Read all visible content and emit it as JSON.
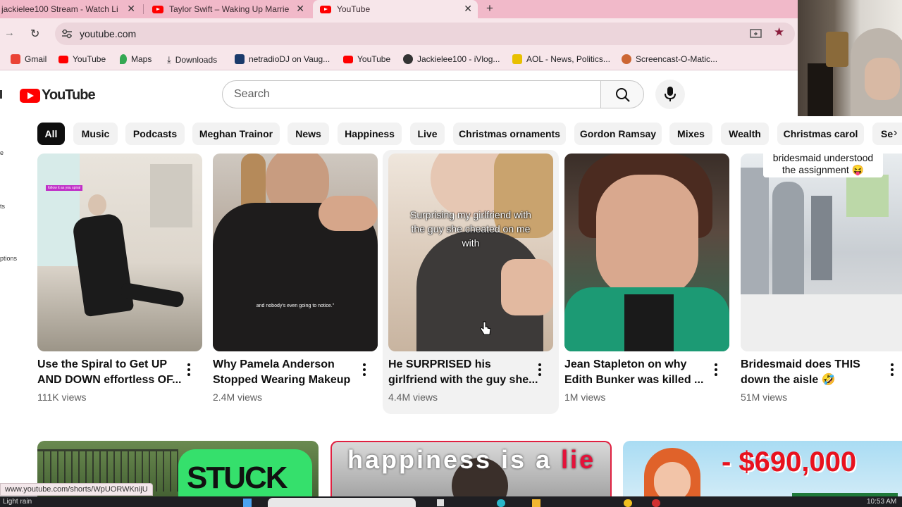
{
  "browser": {
    "tabs": [
      {
        "title": "jackielee100 Stream - Watch Li"
      },
      {
        "title": "Taylor Swift – Waking Up Marrie"
      },
      {
        "title": "YouTube"
      }
    ],
    "new_tab_label": "+",
    "url": "youtube.com",
    "bookmarks": [
      {
        "label": "Gmail",
        "icon": "gmail-icon",
        "color": "#ea4335"
      },
      {
        "label": "YouTube",
        "icon": "youtube-icon",
        "color": "#ff0000"
      },
      {
        "label": "Maps",
        "icon": "maps-pin-icon",
        "color": "#34a853"
      },
      {
        "label": "Downloads",
        "icon": "download-icon",
        "color": "#333333"
      },
      {
        "label": "netradioDJ on Vaug...",
        "icon": "vaughn-icon",
        "color": "#1a3a6b"
      },
      {
        "label": "YouTube",
        "icon": "youtube-icon",
        "color": "#ff0000"
      },
      {
        "label": "Jackielee100 - iVlog...",
        "icon": "site-icon",
        "color": "#333333"
      },
      {
        "label": "AOL - News, Politics...",
        "icon": "aol-icon",
        "color": "#e8c000"
      },
      {
        "label": "Screencast-O-Matic...",
        "icon": "screencast-icon",
        "color": "#cc6633"
      }
    ],
    "status_url": "www.youtube.com/shorts/WpUORWKnijU"
  },
  "youtube": {
    "logo_text": "YouTube",
    "search": {
      "placeholder": "Search"
    },
    "chips": [
      "All",
      "Music",
      "Podcasts",
      "Meghan Trainor",
      "News",
      "Happiness",
      "Live",
      "Christmas ornaments",
      "Gordon Ramsay",
      "Mixes",
      "Wealth",
      "Christmas carol",
      "Se"
    ],
    "left_nav": [
      "e",
      "ts",
      "ptions"
    ],
    "videos": [
      {
        "title1": "Use the Spiral to Get UP",
        "title2": "AND DOWN effortless OF...",
        "views": "111K views",
        "overlay_tag": "follow it as you spiral"
      },
      {
        "title1": "Why Pamela Anderson",
        "title2": "Stopped Wearing Makeup",
        "views": "2.4M views",
        "overlay": "and nobody's even going to notice.\""
      },
      {
        "title1": "He SURPRISED his",
        "title2": "girlfriend with the guy she...",
        "views": "4.4M views",
        "overlay": "Surprising my girlfriend with the guy she cheated on me with"
      },
      {
        "title1": "Jean Stapleton on why",
        "title2": "Edith Bunker was killed ...",
        "views": "1M views"
      },
      {
        "title1": "Bridesmaid does THIS",
        "title2": "down the aisle 🤣",
        "views": "51M views",
        "overlay": "bridesmaid understood the assignment 😝"
      }
    ],
    "bottom_row": [
      {
        "text": "STUCK IN"
      },
      {
        "text_a": "happiness is a ",
        "text_b": "lie"
      },
      {
        "text": "- $690,000"
      }
    ]
  },
  "taskbar": {
    "left_text": "Light rain",
    "time": "10:53 AM"
  }
}
